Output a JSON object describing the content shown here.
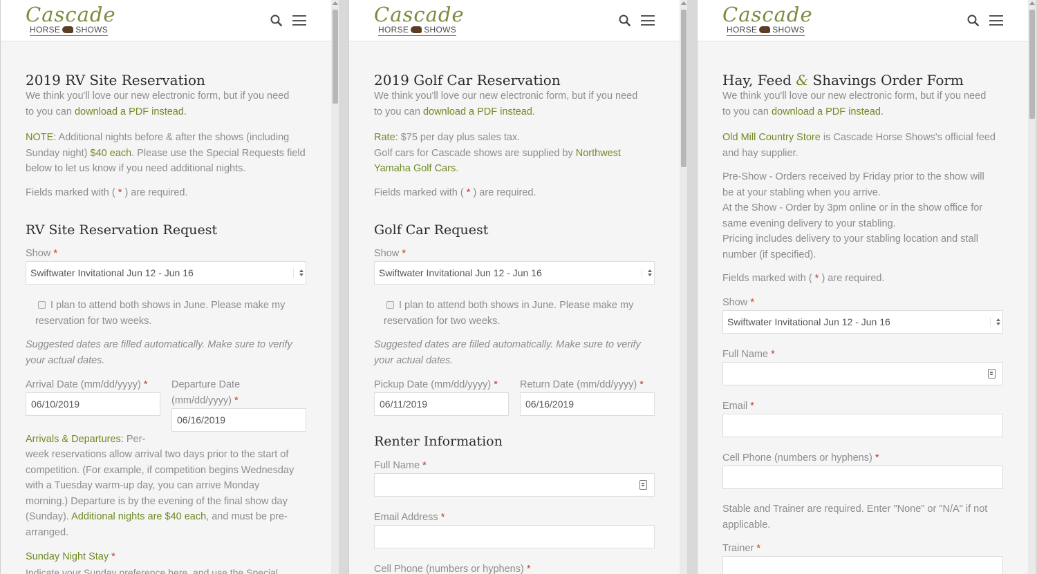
{
  "logo": {
    "main": "Cascade",
    "sub_left": "HORSE",
    "sub_right": "SHOWS"
  },
  "intro": {
    "line1": "We think you'll love our new electronic form, but if you need",
    "line2_prefix": "to you can ",
    "line2_link": "download a PDF instead."
  },
  "fields_required": {
    "prefix": "Fields marked with ( ",
    "star": "*",
    "suffix": " ) are required."
  },
  "panel1": {
    "title": "2019 RV Site Reservation",
    "note_label": "NOTE:",
    "note_line1": " Additional nights before & after the shows (including",
    "note_line2a": "Sunday night) ",
    "note_highlight": "$40 each",
    "note_line2b": ". Please use the Special Requests field",
    "note_line3": "below to let us know if you need additional nights.",
    "section_title": "RV Site Reservation Request",
    "show_label": "Show",
    "show_value": "Swiftwater Invitational Jun 12 - Jun 16",
    "checkbox_line1": "I plan to attend both shows in June. Please make my",
    "checkbox_line2": "reservation for two weeks.",
    "suggested_line1": "Suggested dates are filled automatically. Make sure to verify",
    "suggested_line2": "your actual dates.",
    "arrival_label": "Arrival Date (mm/dd/yyyy)",
    "arrival_value": "06/10/2019",
    "departure_label_1": "Departure Date",
    "departure_label_2": "(mm/dd/yyyy)",
    "departure_value": "06/16/2019",
    "arrivals_label": "Arrivals & Departures:",
    "arrivals_l1": " Per-",
    "arrivals_l2": "week reservations allow arrival two days prior to the start of",
    "arrivals_l3": "competition. (For example, if competition begins Wednesday",
    "arrivals_l4": "with a Tuesday warm-up day, you can arrive Monday",
    "arrivals_l5": "morning.) Departure is by the evening of the final show day",
    "arrivals_l6a": "(Sunday). ",
    "arrivals_l6_hl": "Additional nights are $40 each",
    "arrivals_l6b": ", and must be pre-",
    "arrivals_l7": "arranged.",
    "sunday_label": "Sunday Night Stay",
    "sunday_hint": "Indicate your Sunday preference here, and use the Special"
  },
  "panel2": {
    "title": "2019 Golf Car Reservation",
    "rate_label": "Rate:",
    "rate_text": " $75 per day plus sales tax.",
    "supplied_line1": "Golf cars for Cascade shows are supplied by ",
    "supplier_part1": "Northwest",
    "supplier_part2": "Yamaha Golf Cars",
    "supplied_end": ".",
    "section_title": "Golf Car Request",
    "show_label": "Show",
    "show_value": "Swiftwater Invitational Jun 12 - Jun 16",
    "checkbox_line1": "I plan to attend both shows in June. Please make my",
    "checkbox_line2": "reservation for two weeks.",
    "suggested_line1": "Suggested dates are filled automatically. Make sure to verify",
    "suggested_line2": "your actual dates.",
    "pickup_label": "Pickup Date (mm/dd/yyyy)",
    "pickup_value": "06/11/2019",
    "return_label": "Return Date (mm/dd/yyyy)",
    "return_value": "06/16/2019",
    "renter_title": "Renter Information",
    "fullname_label": "Full Name",
    "email_label": "Email Address",
    "phone_label": "Cell Phone (numbers or hyphens)"
  },
  "panel3": {
    "title_a": "Hay, Feed ",
    "title_amp": "&",
    "title_b": " Shavings Order Form",
    "store_name": "Old Mill Country Store",
    "store_l1": " is Cascade Horse Shows's official feed",
    "store_l2": "and hay supplier.",
    "pre_l1": "Pre-Show - Orders received by Friday prior to the show will",
    "pre_l2": "be at your stabling when you arrive.",
    "at_l1": "At the Show - Order by 3pm online or in the show office for",
    "at_l2": "same evening delivery to your stabling.",
    "price_l1": "Pricing includes delivery to your stabling location and stall",
    "price_l2": "number (if specified).",
    "show_label": "Show",
    "show_value": "Swiftwater Invitational Jun 12 - Jun 16",
    "fullname_label": "Full Name",
    "email_label": "Email",
    "phone_label": "Cell Phone (numbers or hyphens)",
    "stable_l1": "Stable and Trainer are required. Enter \"None\" or \"N/A\" if not",
    "stable_l2": "applicable.",
    "trainer_label": "Trainer"
  }
}
